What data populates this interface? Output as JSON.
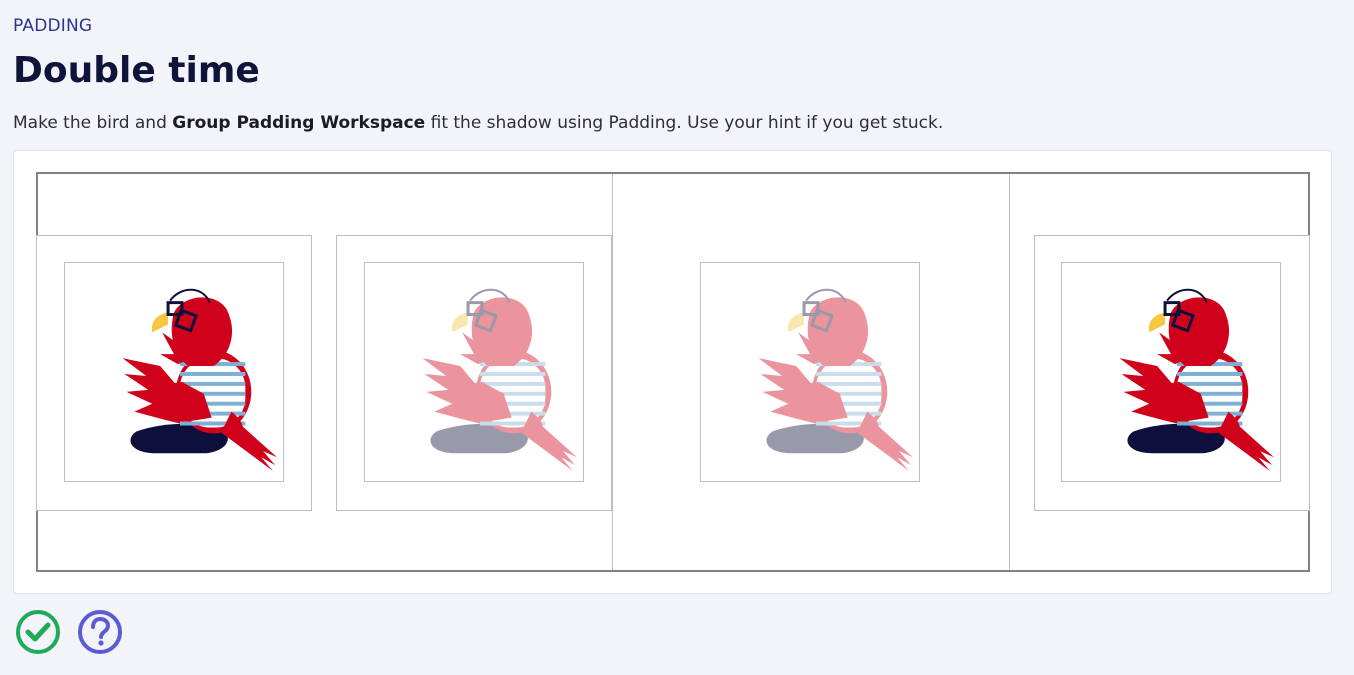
{
  "header": {
    "eyebrow": "PADDING",
    "title": "Double time",
    "instructions_pre": "Make the bird and ",
    "instructions_bold": "Group Padding Workspace",
    "instructions_post": " fit the shadow using Padding. Use your hint if you get stuck."
  },
  "workspace": {
    "birds": [
      {
        "id": "bird-1",
        "state": "solid"
      },
      {
        "id": "bird-2",
        "state": "shadow"
      },
      {
        "id": "bird-3",
        "state": "shadow"
      },
      {
        "id": "bird-4",
        "state": "solid"
      }
    ]
  },
  "actions": {
    "check_icon": "check-circle-icon",
    "hint_icon": "question-circle-icon"
  },
  "colors": {
    "accent": "#2e3192",
    "check": "#1faa59",
    "hint": "#5b5bd6",
    "bird_red": "#d0021b",
    "bird_navy": "#0f0f3c",
    "stripe_blue": "#7fb0d3",
    "beak_yellow": "#f5c842"
  }
}
